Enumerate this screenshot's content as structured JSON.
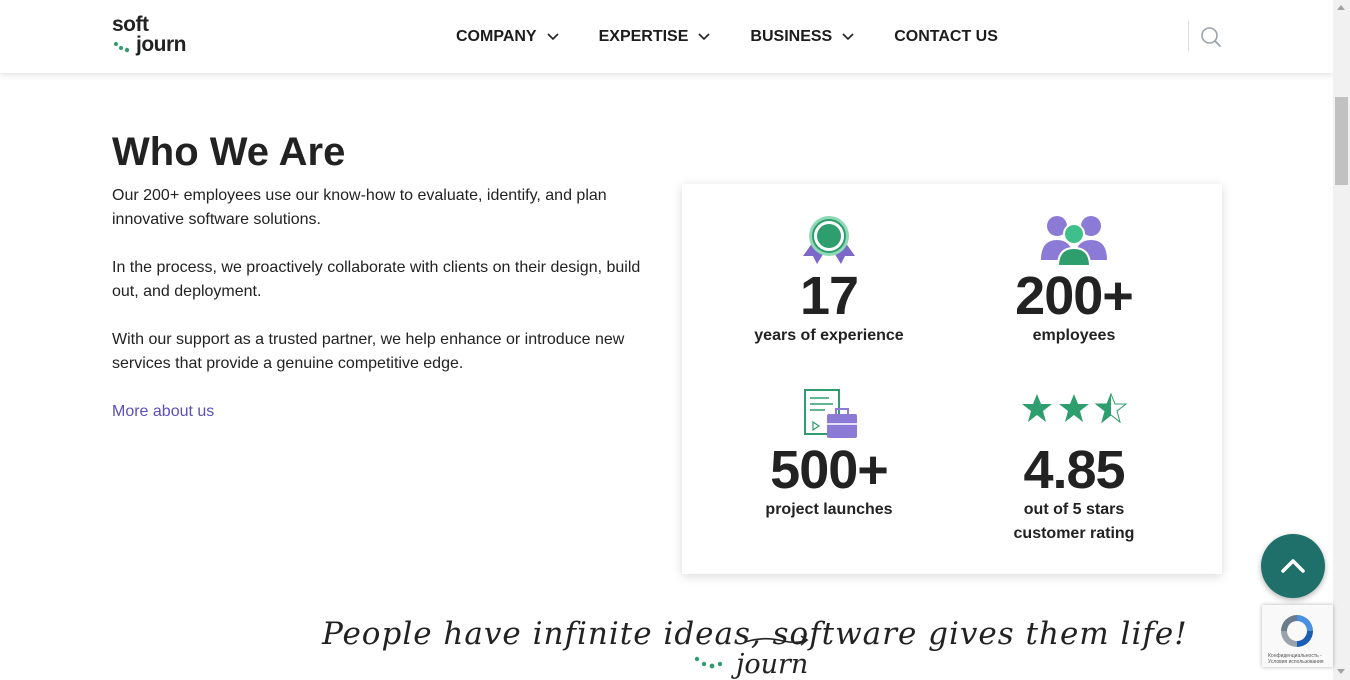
{
  "header": {
    "logo_top": "soft",
    "logo_bottom": "journ",
    "nav": [
      {
        "label": "COMPANY",
        "has_dropdown": true
      },
      {
        "label": "EXPERTISE",
        "has_dropdown": true
      },
      {
        "label": "BUSINESS",
        "has_dropdown": true
      },
      {
        "label": "CONTACT US",
        "has_dropdown": false
      }
    ],
    "search_icon": "search-icon"
  },
  "who_we_are": {
    "title": "Who We Are",
    "paragraphs": [
      "Our 200+ employees use our know-how to evaluate, identify, and plan innovative software solutions.",
      "In the process, we proactively collaborate with clients on their design, build out, and deployment.",
      "With our support as a trusted partner, we help enhance or introduce new services that provide a genuine competitive edge."
    ],
    "more_link": "More about us"
  },
  "stats": [
    {
      "icon": "award-ribbon-icon",
      "value": "17",
      "label": "years of experience"
    },
    {
      "icon": "team-people-icon",
      "value": "200+",
      "label": "employees"
    },
    {
      "icon": "document-briefcase-icon",
      "value": "500+",
      "label": "project launches"
    },
    {
      "icon": "stars-rating-icon",
      "value": "4.85",
      "label_line1": "out of 5 stars",
      "label_line2": "customer rating",
      "stars": 2.5
    }
  ],
  "slogan": {
    "part1": "People have infinite ideas, soft",
    "struck": "ware",
    "part2": " gives them life!",
    "journ": "journ"
  },
  "recaptcha_text": "Конфиденциальность - Условия использования",
  "colors": {
    "accent_green": "#2e9e6e",
    "accent_purple": "#7b68c8",
    "link_purple": "#5b4fb8",
    "up_button": "#1f6f6a"
  }
}
